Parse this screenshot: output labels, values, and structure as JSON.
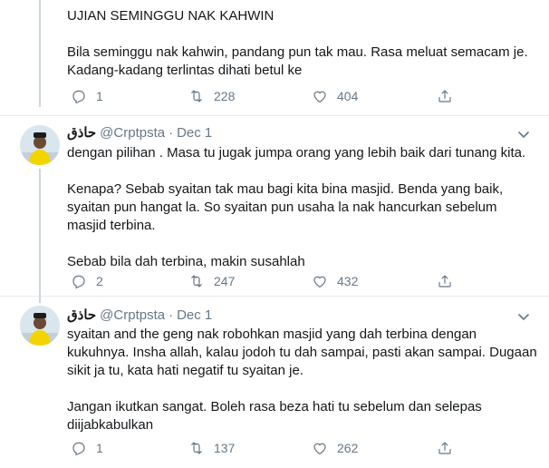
{
  "tweets": [
    {
      "text": "UJIAN SEMINGGU NAK KAHWIN\n\nBila seminggu nak kahwin, pandang pun tak mau. Rasa meluat semacam je.\nKadang-kadang terlintas dihati betul ke",
      "replies": "1",
      "retweets": "228",
      "likes": "404"
    },
    {
      "name": "حاذق",
      "handle": "@Crptpsta",
      "sep": "·",
      "date": "Dec 1",
      "text": "dengan pilihan . Masa tu jugak jumpa orang yang lebih baik dari tunang kita.\n\nKenapa? Sebab syaitan tak mau bagi kita bina masjid. Benda yang baik,\nsyaitan pun hangat la. So syaitan pun usaha la nak hancurkan sebelum\nmasjid terbina.\n\nSebab bila dah terbina, makin susahlah",
      "replies": "2",
      "retweets": "247",
      "likes": "432"
    },
    {
      "name": "حاذق",
      "handle": "@Crptpsta",
      "sep": "·",
      "date": "Dec 1",
      "text": "syaitan and the geng nak robohkan masjid yang dah terbina dengan\nkukuhnya. Insha allah, kalau jodoh tu dah sampai, pasti akan sampai. Dugaan\nsikit ja tu, kata hati negatif tu syaitan je.\n\nJangan ikutkan sangat. Boleh rasa beza hati tu sebelum dan selepas\ndiijabkabulkan",
      "replies": "1",
      "retweets": "137",
      "likes": "262"
    }
  ],
  "colors": {
    "text": "#14171a",
    "secondary": "#657786",
    "thread_line": "#ccd6dd",
    "divider": "#e6ecf0",
    "avatar_shirt": "#f2d500"
  },
  "icons": [
    "reply-icon",
    "retweet-icon",
    "like-icon",
    "share-icon",
    "chevron-down-icon"
  ]
}
